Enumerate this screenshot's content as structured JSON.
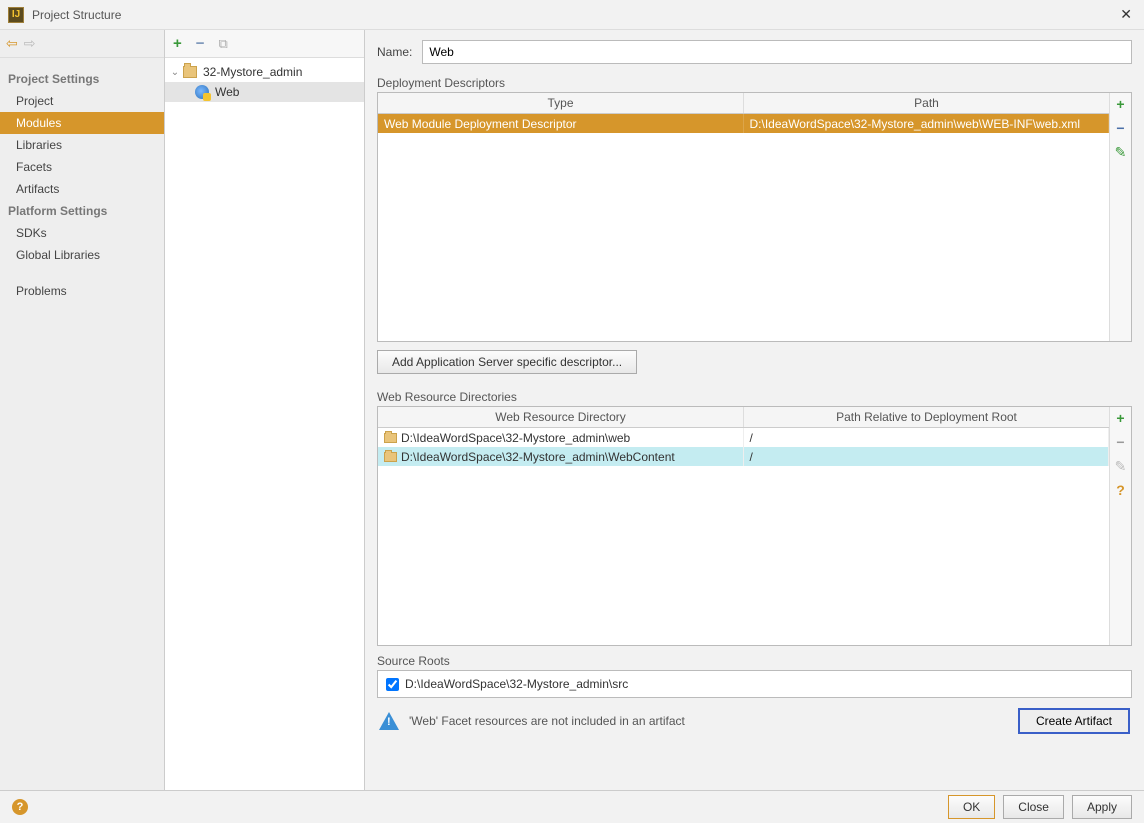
{
  "title": "Project Structure",
  "sidebar": {
    "groups": [
      {
        "title": "Project Settings",
        "items": [
          "Project",
          "Modules",
          "Libraries",
          "Facets",
          "Artifacts"
        ],
        "selectedIndex": 1
      },
      {
        "title": "Platform Settings",
        "items": [
          "SDKs",
          "Global Libraries"
        ]
      },
      {
        "title": "",
        "items": [
          "Problems"
        ]
      }
    ]
  },
  "tree": {
    "root": {
      "label": "32-Mystore_admin",
      "expanded": true
    },
    "child": {
      "label": "Web",
      "selected": true
    }
  },
  "form": {
    "name_label": "Name:",
    "name_value": "Web"
  },
  "descriptors": {
    "section_label": "Deployment Descriptors",
    "columns": [
      "Type",
      "Path"
    ],
    "rows": [
      {
        "type": "Web Module Deployment Descriptor",
        "path": "D:\\IdeaWordSpace\\32-Mystore_admin\\web\\WEB-INF\\web.xml",
        "selected": true
      }
    ],
    "add_server_button": "Add Application Server specific descriptor..."
  },
  "resources": {
    "section_label": "Web Resource Directories",
    "columns": [
      "Web Resource Directory",
      "Path Relative to Deployment Root"
    ],
    "rows": [
      {
        "dir": "D:\\IdeaWordSpace\\32-Mystore_admin\\web",
        "path": "/",
        "selected": false
      },
      {
        "dir": "D:\\IdeaWordSpace\\32-Mystore_admin\\WebContent",
        "path": "/",
        "selected": true
      }
    ]
  },
  "source_roots": {
    "section_label": "Source Roots",
    "items": [
      {
        "label": "D:\\IdeaWordSpace\\32-Mystore_admin\\src",
        "checked": true
      }
    ]
  },
  "warning": {
    "text": "'Web' Facet resources are not included in an artifact",
    "button": "Create Artifact"
  },
  "footer": {
    "ok": "OK",
    "close": "Close",
    "apply": "Apply"
  }
}
